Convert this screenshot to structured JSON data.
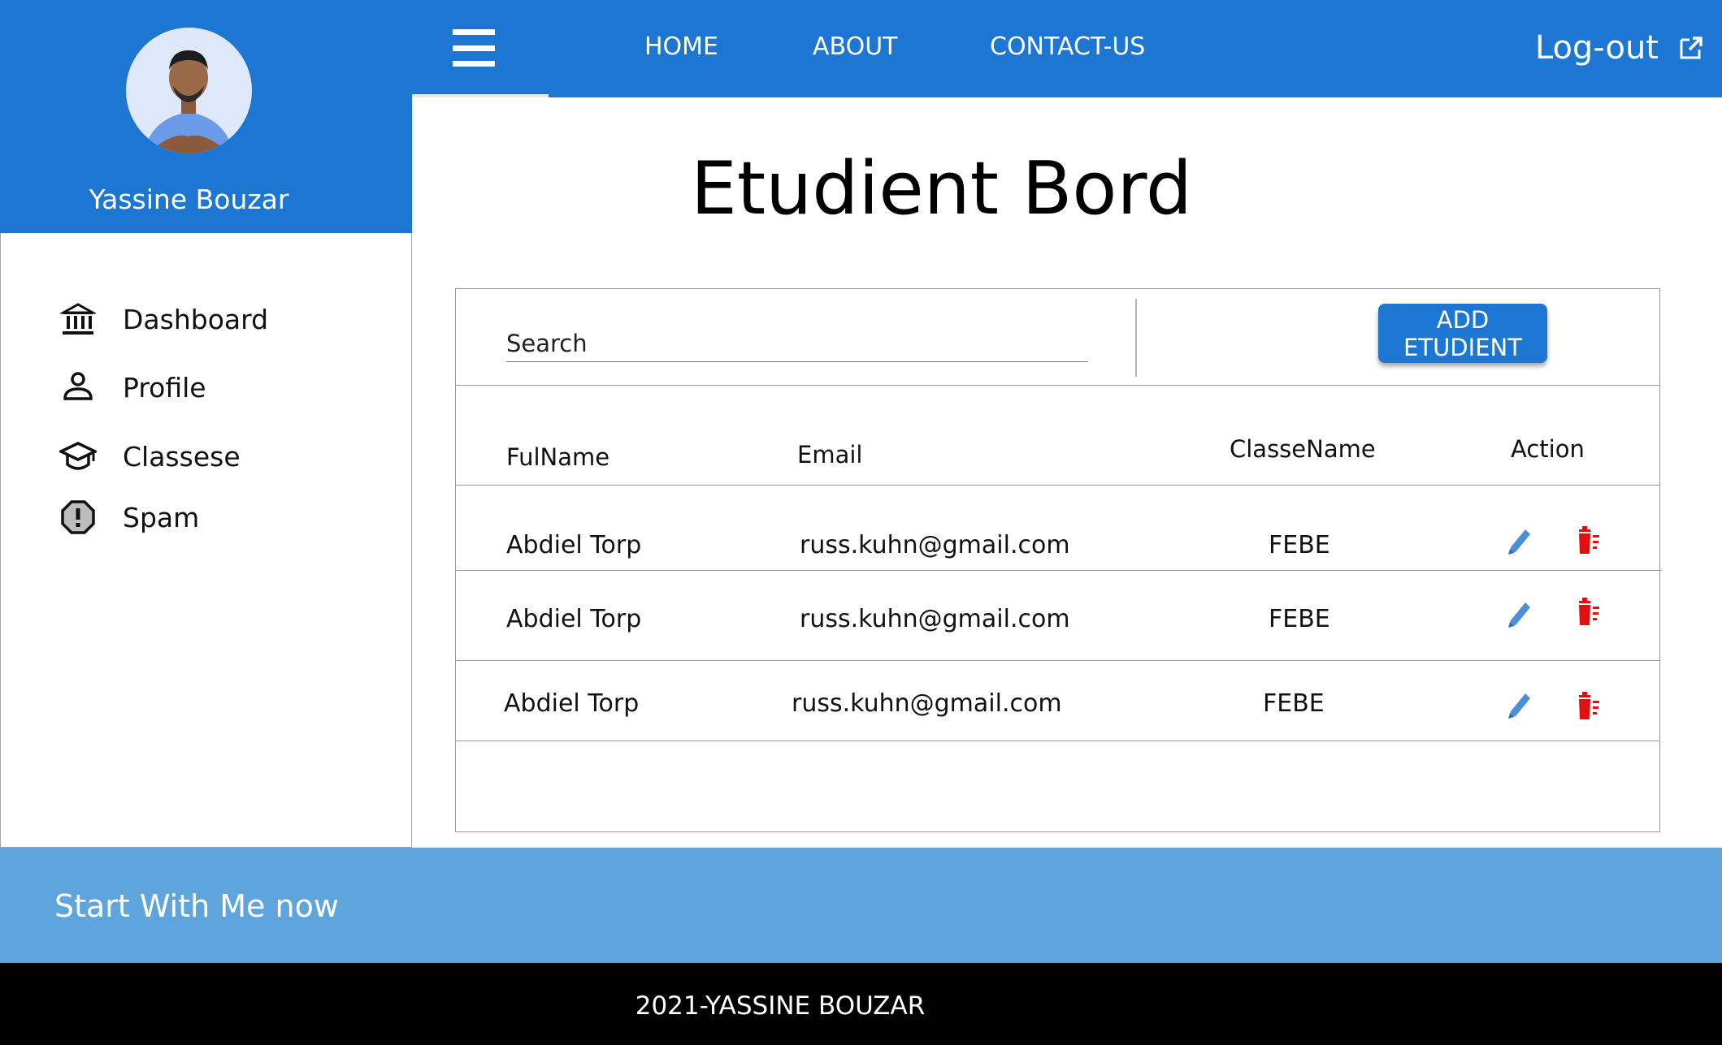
{
  "sidebar": {
    "user_name": "Yassine Bouzar",
    "items": [
      {
        "label": "Dashboard",
        "icon": "bank-icon"
      },
      {
        "label": "Profile",
        "icon": "person-icon"
      },
      {
        "label": "Classese",
        "icon": "graduation-cap-icon"
      },
      {
        "label": "Spam",
        "icon": "warning-octagon-icon"
      }
    ]
  },
  "topbar": {
    "nav": [
      "HOME",
      "ABOUT",
      "CONTACT-US"
    ],
    "logout_label": "Log-out",
    "menu_icon": "hamburger-menu-icon",
    "logout_icon": "external-link-icon"
  },
  "main": {
    "title": "Etudient Bord",
    "search_placeholder": "Search",
    "add_button": "ADD ETUDIENT",
    "table": {
      "columns": [
        "FulName",
        "Email",
        "ClasseName",
        "Action"
      ],
      "rows": [
        {
          "name": "Abdiel Torp",
          "email": "russ.kuhn@gmail.com",
          "classe": "FEBE"
        },
        {
          "name": "Abdiel Torp",
          "email": "russ.kuhn@gmail.com",
          "classe": "FEBE"
        },
        {
          "name": "Abdiel Torp",
          "email": "russ.kuhn@gmail.com",
          "classe": "FEBE"
        }
      ],
      "action_icons": [
        "pencil-icon",
        "trash-icon"
      ]
    }
  },
  "cta": {
    "text": "Start With Me now"
  },
  "footer": {
    "text": "2021-YASSINE BOUZAR"
  },
  "colors": {
    "primary": "#1c76d2",
    "cta": "#5ea5de",
    "footer": "#000000",
    "edit": "#4a90d9",
    "delete": "#e01010"
  }
}
